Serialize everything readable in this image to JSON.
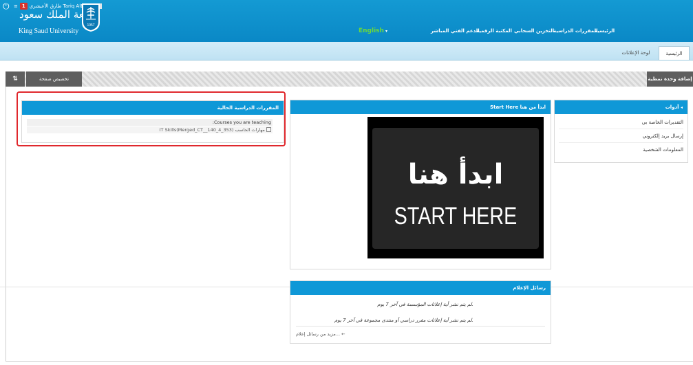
{
  "header": {
    "user_name": "طارق الأعيشري  Tariq AlBishri",
    "notification_count": "1",
    "logo_ar": "جامعة الملك سعود",
    "logo_en": "King Saud University",
    "emblem_year": "1957",
    "colors": {
      "bar": "#0a8ec9",
      "active_nav": "#6dd93a"
    }
  },
  "nav": {
    "home": "الرئيسية",
    "courses": "المقررات الدراسية",
    "cloud": "التخزين السحابي",
    "library": "المكتبة الرقمية",
    "support": "الدعم الفني المباشر",
    "english": "English"
  },
  "tabs": {
    "home": "الرئيسية",
    "announcements": "لوحة الإعلانات"
  },
  "toolbar": {
    "sort_icon": "⇅",
    "customize": "تخصيص صفحة",
    "add_module": "إضافة وحدة نمطية"
  },
  "tools": {
    "title": "أدوات",
    "items": [
      "التقديرات الخاصة بي",
      "إرسال بريد إلكتروني",
      "المعلومات الشخصية"
    ]
  },
  "start": {
    "title": "Start Here ابدأ من هنا",
    "image_ar": "ابدأ هنا",
    "image_en": "START HERE"
  },
  "courses": {
    "title": "المقررات الدراسية الحالية",
    "teaching": ":Courses you are teaching",
    "item": "IT Skills(Merged_CT__140_4_353) مهارات الحاسب"
  },
  "announcements": {
    "title": "رسائل الإعلام",
    "msg1": "لم يتم نشر أية إعلانات المؤسسة في آخر 7 يوم.",
    "msg2": "لم يتم نشر أية إعلانات مقرر دراسي أو منتدى مجموعة في آخر 7 يوم.",
    "more": "مزيد من رسائل إعلام... ←"
  }
}
